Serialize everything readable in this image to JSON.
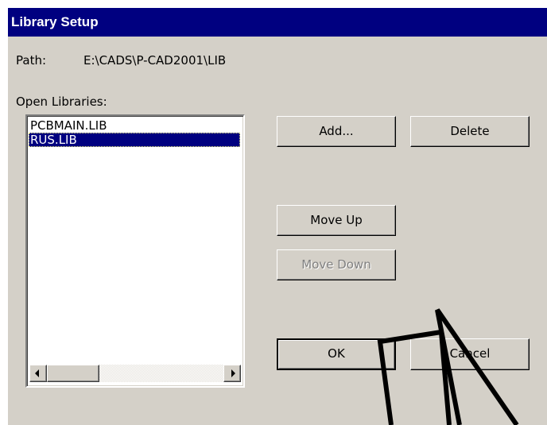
{
  "window": {
    "title": "Library Setup"
  },
  "path": {
    "label": "Path:",
    "value": "E:\\CADS\\P-CAD2001\\LIB"
  },
  "libraries": {
    "label": "Open Libraries:",
    "items": [
      {
        "name": "PCBMAIN.LIB",
        "selected": false
      },
      {
        "name": "RUS.LIB",
        "selected": true
      }
    ]
  },
  "buttons": {
    "add": "Add...",
    "delete": "Delete",
    "move_up": "Move Up",
    "move_down": "Move Down",
    "ok": "OK",
    "cancel": "Cancel"
  },
  "colors": {
    "title_bar": "#000080",
    "dialog_face": "#d4d0c8",
    "selection": "#000080",
    "disabled_text": "#808080"
  },
  "icons": [
    "scroll-left-arrow-icon",
    "scroll-right-arrow-icon"
  ]
}
